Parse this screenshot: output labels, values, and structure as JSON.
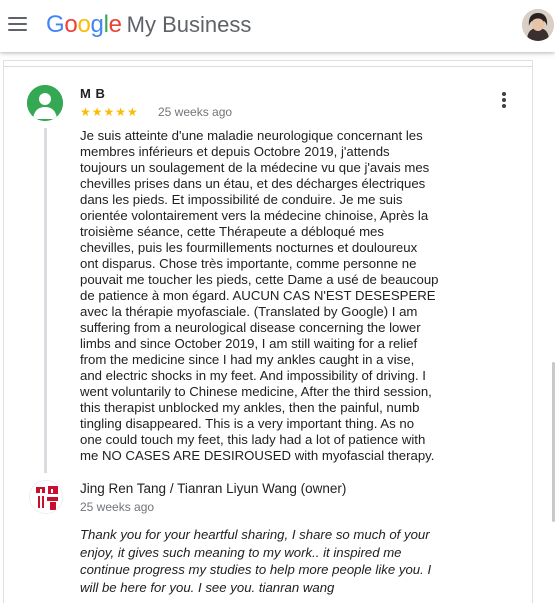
{
  "header": {
    "menu_icon": "menu-icon",
    "logo_letters": [
      "G",
      "o",
      "o",
      "g",
      "l",
      "e"
    ],
    "product_name": "My Business",
    "account_avatar": "account-avatar"
  },
  "review": {
    "reviewer_name": "M B",
    "rating": 5,
    "stars_text": "★★★★★",
    "age": "25 weeks ago",
    "more_options_icon": "more-vert-icon",
    "text": "Je suis atteinte d'une maladie neurologique concernant les\nmembres inférieurs et depuis Octobre 2019, j'attends\ntoujours un soulagement de la médecine vu que j'avais mes\nchevilles prises dans un étau, et des décharges électriques\ndans les pieds. Et impossibilité de conduire. Je me suis\norientée volontairement vers la médecine chinoise, Après la\ntroisième séance, cette Thérapeute a débloqué mes\nchevilles, puis les fourmillements nocturnes et douloureux\nont disparus. Chose très importante, comme personne ne\npouvait me toucher les pieds, cette Dame a usé de beaucoup\nde patience à mon égard. AUCUN CAS N'EST DESESPERE\navec la thérapie myofasciale. (Translated by Google) I am\nsuffering from a neurological disease concerning the lower\nlimbs and since October 2019, I am still waiting for a relief\nfrom the medicine since I had my ankles caught in a vise,\nand electric shocks in my feet. And impossibility of driving. I\nwent voluntarily to Chinese medicine, After the third session,\nthis therapist unblocked my ankles, then the painful, numb\ntingling disappeared. This is a very important thing. As no\none could touch my feet, this lady had a lot of patience with\nme NO CASES ARE DESIROUSED with myofascial therapy."
  },
  "owner_reply": {
    "name": "Jing Ren Tang / Tianran Liyun Wang (owner)",
    "age": "25 weeks ago",
    "text": "Thank you for your heartful sharing, I share so much of your\nenjoy,    it gives such meaning to my work.. it inspired me\ncontinue progress my studies to help more people like you. I\nwill be here for you. I see you. tianran wang"
  }
}
